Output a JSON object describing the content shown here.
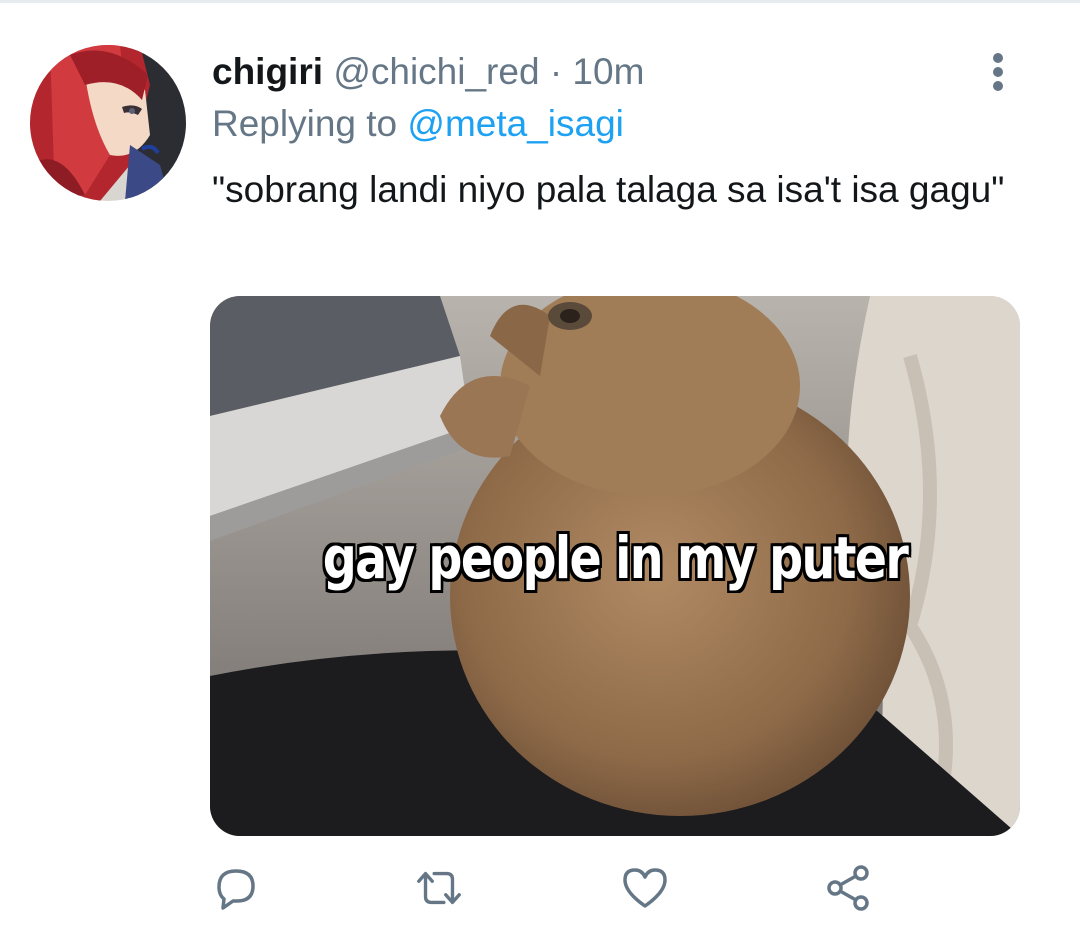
{
  "tweet": {
    "author_name": "chigiri",
    "author_handle": "@chichi_red",
    "separator": "·",
    "timestamp": "10m",
    "replying_prefix": "Replying to",
    "replying_to": "@meta_isagi",
    "text": "\"sobrang landi niyo pala talaga sa isa't isa gagu\"",
    "media": {
      "caption": "gay people in my puter"
    }
  },
  "icons": {
    "more": "more-vertical-icon",
    "reply": "reply-icon",
    "retweet": "retweet-icon",
    "like": "heart-icon",
    "share": "share-icon"
  },
  "colors": {
    "text": "#14171a",
    "secondary": "#657786",
    "link": "#1da1f2",
    "icon": "#657786"
  }
}
